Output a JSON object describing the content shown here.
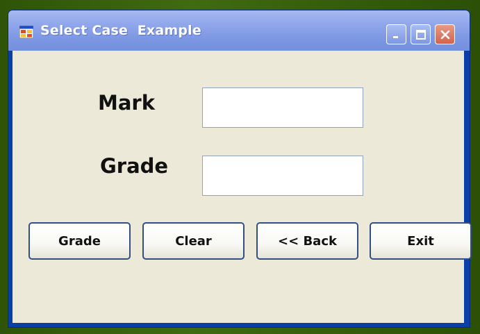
{
  "window": {
    "title": "Select Case  Example"
  },
  "titlebar_buttons": {
    "minimize_icon": "minimize-icon",
    "maximize_icon": "maximize-icon",
    "close_icon": "close-icon"
  },
  "form": {
    "mark_label": "Mark",
    "mark_value": "",
    "grade_label": "Grade",
    "grade_value": ""
  },
  "buttons": {
    "grade": "Grade",
    "clear": "Clear",
    "back": "<< Back",
    "exit": "Exit"
  },
  "colors": {
    "titlebar": "#7f99e4",
    "client_background": "#ece9d8",
    "close_button": "#d4634c",
    "window_frame": "#0a3ea8"
  }
}
